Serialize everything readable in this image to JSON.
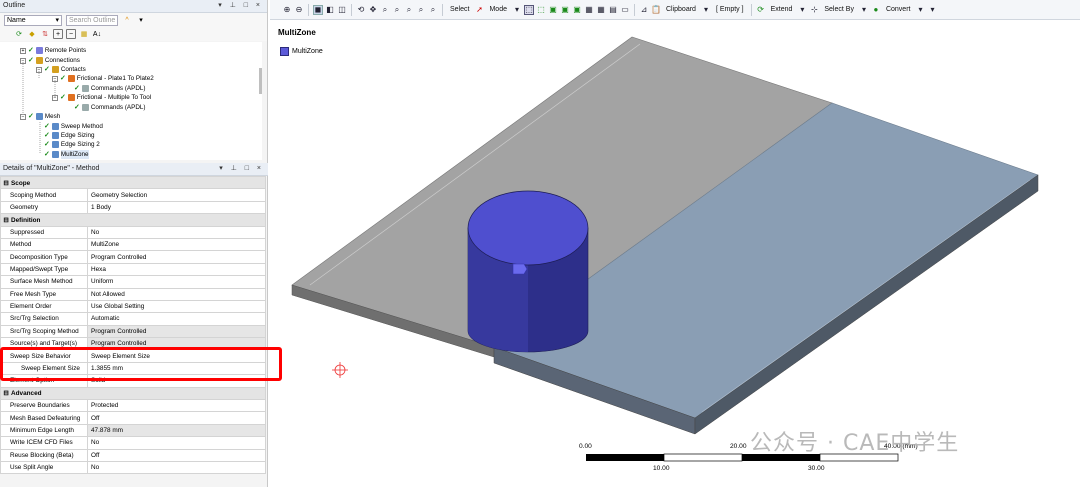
{
  "outline": {
    "title": "Outline",
    "name_select": "Name",
    "search_placeholder": "Search Outline",
    "tree": [
      {
        "label": "Remote Points"
      },
      {
        "label": "Connections"
      },
      {
        "label": "Contacts"
      },
      {
        "label": "Frictional - Plate1 To Plate2"
      },
      {
        "label": "Commands (APDL)"
      },
      {
        "label": "Frictional - Multiple To Tool"
      },
      {
        "label": "Commands (APDL)"
      },
      {
        "label": "Mesh"
      },
      {
        "label": "Sweep Method"
      },
      {
        "label": "Edge Sizing"
      },
      {
        "label": "Edge Sizing 2"
      },
      {
        "label": "MultiZone"
      }
    ]
  },
  "details": {
    "title": "Details of \"MultiZone\" - Method",
    "rows": [
      {
        "group": "Scope"
      },
      {
        "k": "Scoping Method",
        "v": "Geometry Selection"
      },
      {
        "k": "Geometry",
        "v": "1 Body"
      },
      {
        "group": "Definition"
      },
      {
        "k": "Suppressed",
        "v": "No"
      },
      {
        "k": "Method",
        "v": "MultiZone"
      },
      {
        "k": "Decomposition Type",
        "v": "Program Controlled"
      },
      {
        "k": "Mapped/Swept Type",
        "v": "Hexa"
      },
      {
        "k": "Surface Mesh Method",
        "v": "Uniform"
      },
      {
        "k": "Free Mesh Type",
        "v": "Not Allowed"
      },
      {
        "k": "Element Order",
        "v": "Use Global Setting"
      },
      {
        "k": "Src/Trg Selection",
        "v": "Automatic"
      },
      {
        "k": "Src/Trg Scoping Method",
        "v": "Program Controlled"
      },
      {
        "k": "Source(s) and Target(s)",
        "v": "Program Controlled"
      },
      {
        "k": "Sweep Size Behavior",
        "v": "Sweep Element Size"
      },
      {
        "k": "Sweep Element Size",
        "v": "1.3855 mm"
      },
      {
        "k": "Element Option",
        "v": "Solid"
      },
      {
        "group": "Advanced"
      },
      {
        "k": "Preserve Boundaries",
        "v": "Protected"
      },
      {
        "k": "Mesh Based Defeaturing",
        "v": "Off"
      },
      {
        "k": "Minimum Edge Length",
        "v": "47.878 mm"
      },
      {
        "k": "Write ICEM CFD Files",
        "v": "No"
      },
      {
        "k": "Reuse Blocking (Beta)",
        "v": "Off"
      },
      {
        "k": "Use Split Angle",
        "v": "No"
      }
    ]
  },
  "toolbar": {
    "select": "Select",
    "mode": "Mode",
    "clipboard": "Clipboard",
    "empty": "[ Empty ]",
    "extend": "Extend",
    "select_by": "Select By",
    "convert": "Convert"
  },
  "viewport": {
    "title": "MultiZone",
    "legend": "MultiZone",
    "legend_color": "#5c5ad8",
    "scale_top": [
      "0.00",
      "20.00",
      "40.00 (mm)"
    ],
    "scale_bottom": [
      "10.00",
      "30.00"
    ]
  },
  "watermark": "公众号 · CAE中学生"
}
